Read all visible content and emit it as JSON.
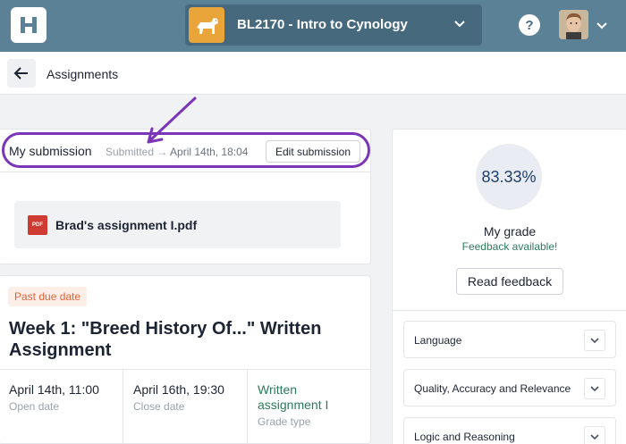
{
  "app": {
    "logo_icon": "app-logo-h",
    "course_title": "BL2170 - Intro to Cynology",
    "help_label": "?",
    "colors": {
      "topbar": "#5b8197",
      "accent_purple": "#7b35b8",
      "success_green": "#2d7a5a",
      "warning_orange": "#e0643a"
    }
  },
  "subheader": {
    "back_icon": "arrow-left-icon",
    "title": "Assignments"
  },
  "submission": {
    "label": "My submission",
    "status": "Submitted",
    "arrow": "→",
    "date": "April 14th, 18:04",
    "edit_button": "Edit submission",
    "file": {
      "icon_text": "PDF",
      "name": "Brad's assignment I.pdf"
    }
  },
  "assignment": {
    "badge": "Past due date",
    "title": "Week 1: \"Breed History Of...\" Written Assignment",
    "meta": [
      {
        "value": "April 14th, 11:00",
        "label": "Open date"
      },
      {
        "value": "April 16th, 19:30",
        "label": "Close date"
      },
      {
        "value": "Written assignment I",
        "label": "Grade type"
      }
    ]
  },
  "grade": {
    "value": "83.33%",
    "label": "My grade",
    "feedback_available": "Feedback available!",
    "read_feedback_button": "Read feedback",
    "criteria": [
      {
        "label": "Language"
      },
      {
        "label": "Quality, Accuracy and Relevance"
      },
      {
        "label": "Logic and Reasoning"
      }
    ]
  }
}
